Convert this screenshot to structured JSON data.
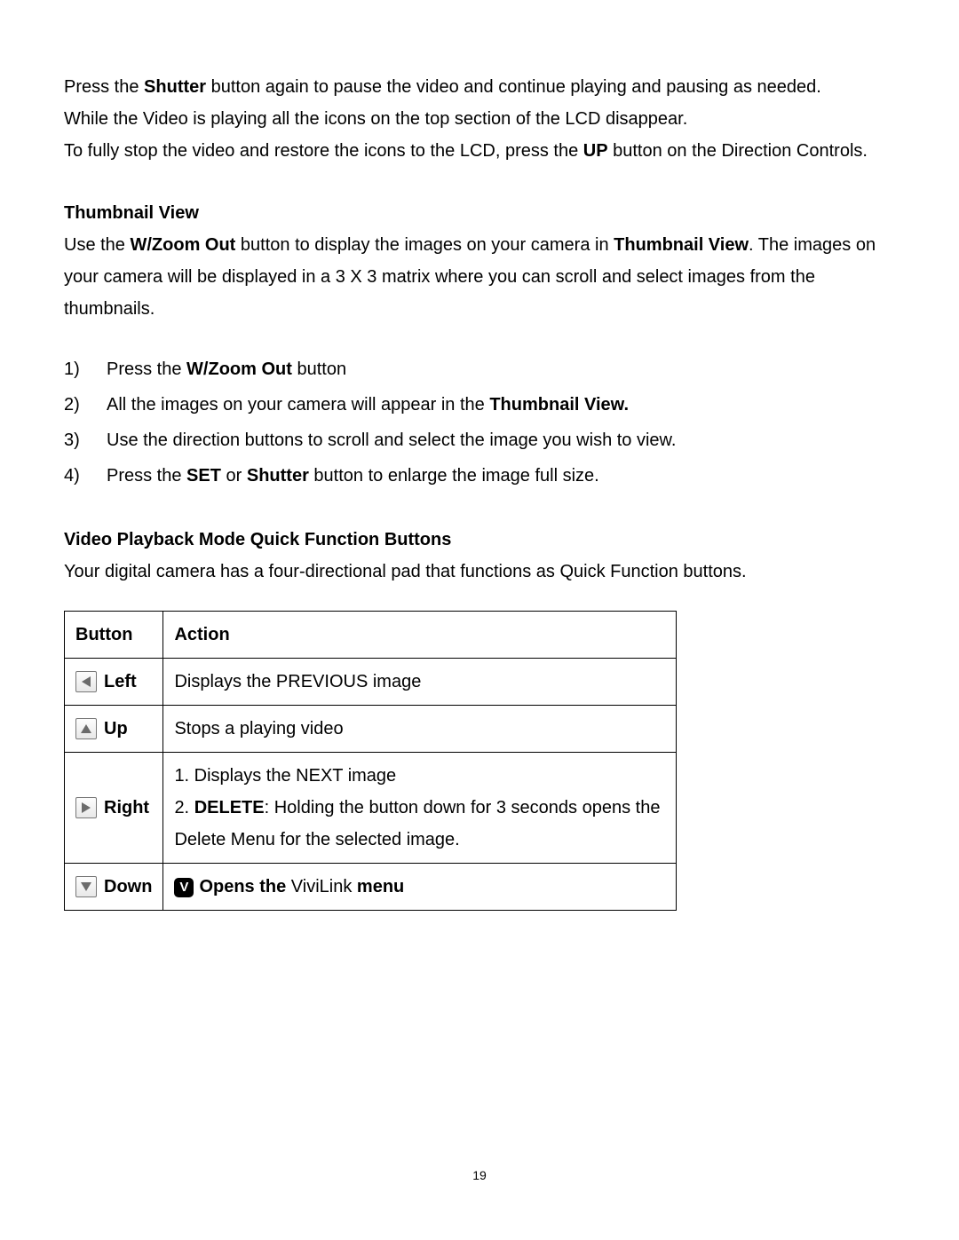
{
  "intro": {
    "line1_a": "Press the ",
    "line1_b": "Shutter",
    "line1_c": " button again to pause the video and continue playing and pausing as needed.",
    "line2": "While the Video is playing all the icons on the top section of the LCD disappear.",
    "line3_a": "To fully stop the video and restore the icons to the LCD, press the ",
    "line3_b": "UP",
    "line3_c": " button on the Direction Controls."
  },
  "thumb": {
    "title": "Thumbnail View",
    "p1_a": "Use the ",
    "p1_b": "W/Zoom Out",
    "p1_c": " button to display the images on your camera in ",
    "p1_d": "Thumbnail View",
    "p1_e": ". The images on your camera will be displayed in a 3 X 3 matrix where you can scroll and select images from the thumbnails.",
    "steps": [
      {
        "n": "1)",
        "a": "Press the ",
        "b": "W/Zoom Out",
        "c": " button"
      },
      {
        "n": "2)",
        "a": "All the images on your camera will appear in the ",
        "b": "Thumbnail View.",
        "c": ""
      },
      {
        "n": "3)",
        "a": "Use the direction buttons to scroll and select the image you wish to view.",
        "b": "",
        "c": ""
      },
      {
        "n": "4)",
        "a": "Press the ",
        "b": "SET",
        "c": " or ",
        "d": "Shutter",
        "e": " button to enlarge the image full size."
      }
    ]
  },
  "video": {
    "title": "Video Playback Mode Quick Function Buttons",
    "intro": "Your digital camera has a four-directional pad that functions as Quick Function buttons.",
    "header": {
      "button": "Button",
      "action": "Action"
    },
    "rows": {
      "left": {
        "label": "Left",
        "action": "Displays the PREVIOUS image"
      },
      "up": {
        "label": "Up",
        "action": "Stops a playing video"
      },
      "right": {
        "label": "Right",
        "line1": "1. Displays the NEXT image",
        "line2_a": "2. ",
        "line2_b": "DELETE",
        "line2_c": ": Holding the button down for 3 seconds opens the Delete Menu for the selected image."
      },
      "down": {
        "label": "Down",
        "badge": "V",
        "a": "Opens the ",
        "b": "ViviLink",
        "c": " menu"
      }
    }
  },
  "page_number": "19"
}
